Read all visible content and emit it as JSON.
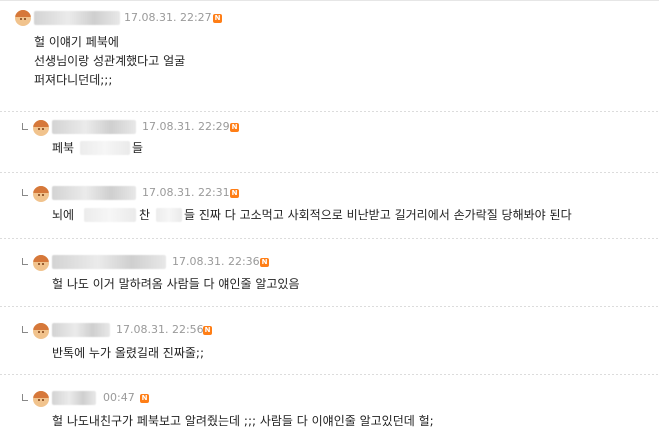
{
  "comments": [
    {
      "time": "17.08.31. 22:27",
      "badge": "N",
      "lines": [
        "헐 이얘기 페북에",
        "선생님이랑 성관계했다고 얼굴",
        "퍼져다니던데;;;"
      ]
    },
    {
      "time": "17.08.31. 22:29",
      "badge": "N",
      "pre": "페북",
      "post": "들"
    },
    {
      "time": "17.08.31. 22:31",
      "badge": "N",
      "pre": "뇌에",
      "mid": "찬",
      "post": "들 진짜 다 고소먹고 사회적으로 비난받고 길거리에서 손가락질 당해봐야 된다"
    },
    {
      "time": "17.08.31. 22:36",
      "badge": "N",
      "text": "헐 나도 이거 말하려옴 사람들 다 얘인줄 알고있음"
    },
    {
      "time": "17.08.31. 22:56",
      "badge": "N",
      "text": "반톡에 누가 올렸길래 진짜줄;;"
    },
    {
      "time": "00:47",
      "badge": "N",
      "text": "헐 나도내친구가 페북보고 알려줬는데 ;;; 사람들 다 이얘인줄 알고있던데 헐;"
    }
  ]
}
